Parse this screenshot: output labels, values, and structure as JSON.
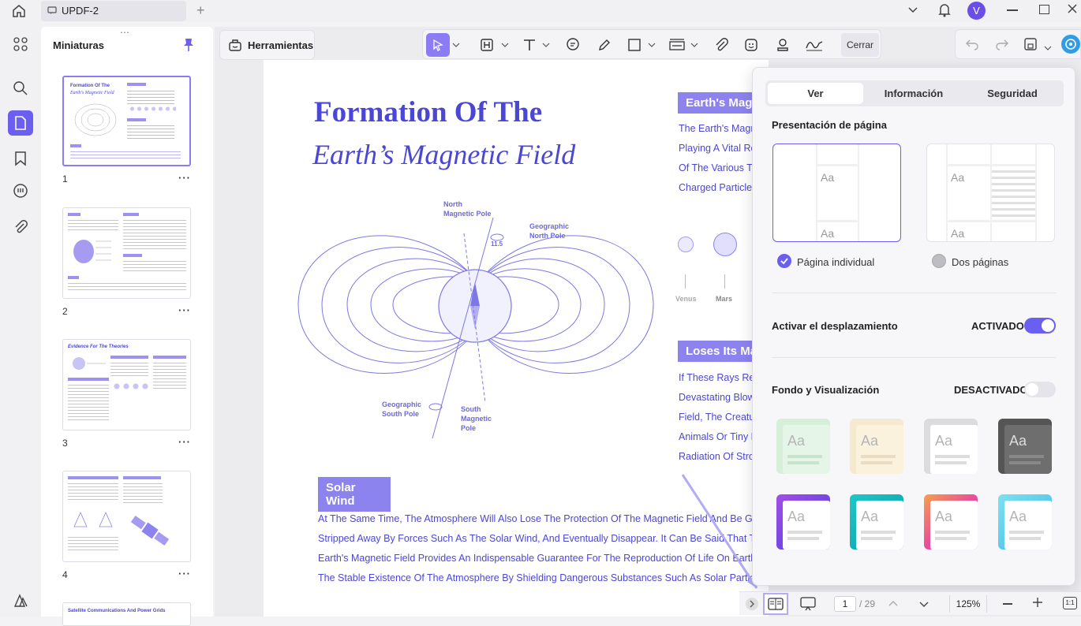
{
  "app": {
    "tab_title": "UPDF-2",
    "avatar_letter": "V"
  },
  "sidebar": {
    "title": "Miniaturas",
    "pages": [
      {
        "num": "1",
        "dots": "···"
      },
      {
        "num": "2",
        "dots": "···"
      },
      {
        "num": "3",
        "dots": "···"
      },
      {
        "num": "4",
        "dots": "···"
      }
    ],
    "thumb1": {
      "title1": "Formation Of The",
      "title2": "Earth's Magnetic Field"
    },
    "thumb3": {
      "title": "Evidence For The Theories"
    },
    "thumb5": {
      "title": "Satellite Communications And Power Grids"
    }
  },
  "toolbar": {
    "tools_label": "Herramientas",
    "close_label": "Cerrar"
  },
  "document": {
    "title1": "Formation Of The",
    "title2": "Earth’s Magnetic Field",
    "labels": {
      "north_mag_1": "North",
      "north_mag_2": "Magnetic Pole",
      "geo_north_1": "Geographic",
      "geo_north_2": "North Pole",
      "angle": "11.5",
      "geo_south_1": "Geographic",
      "geo_south_2": "South Pole",
      "south_mag_1": "South",
      "south_mag_2": "Magnetic",
      "south_mag_3": "Pole"
    },
    "right_heading1": "Earth's Mag",
    "right_lines1": [
      "The Earth's Magne",
      "Playing A Vital Ro",
      "Of The Various Ty",
      "Charged Particle F"
    ],
    "planets": [
      "Venus",
      "Mars"
    ],
    "right_heading2": "Loses Its Mag",
    "right_lines2": [
      "If These Rays Rea",
      "Devastating Blow",
      "Field, The Creatur",
      "Animals Or Tiny M",
      "Radiation Of Stron"
    ],
    "solar_heading": "Solar Wind",
    "solar_lines": [
      "At The Same Time, The Atmosphere Will Also Lose The Protection Of The Magnetic Field And Be Gradual",
      "Stripped Away By Forces Such As The Solar Wind, And Eventually Disappear. It Can Be Said That The",
      "Earth's Magnetic Field Provides An Indispensable Guarantee For The Reproduction Of Life On Earth An",
      "The Stable Existence Of The Atmosphere By Shielding Dangerous Substances Such As Solar Particles."
    ]
  },
  "panel": {
    "tabs": [
      "Ver",
      "Información",
      "Seguridad"
    ],
    "page_presentation": "Presentación de página",
    "single_page": "Página individual",
    "two_pages": "Dos páginas",
    "scroll_label": "Activar el desplazamiento",
    "scroll_state": "ACTIVADO",
    "bg_label": "Fondo y Visualización",
    "bg_state": "DESACTIVADO",
    "aa": "Aa"
  },
  "bottom": {
    "page_current": "1",
    "page_total": "/ 29",
    "zoom": "125%"
  },
  "colors": {
    "accent": "#6b5ff2",
    "doc_purple": "#4b47d6"
  }
}
